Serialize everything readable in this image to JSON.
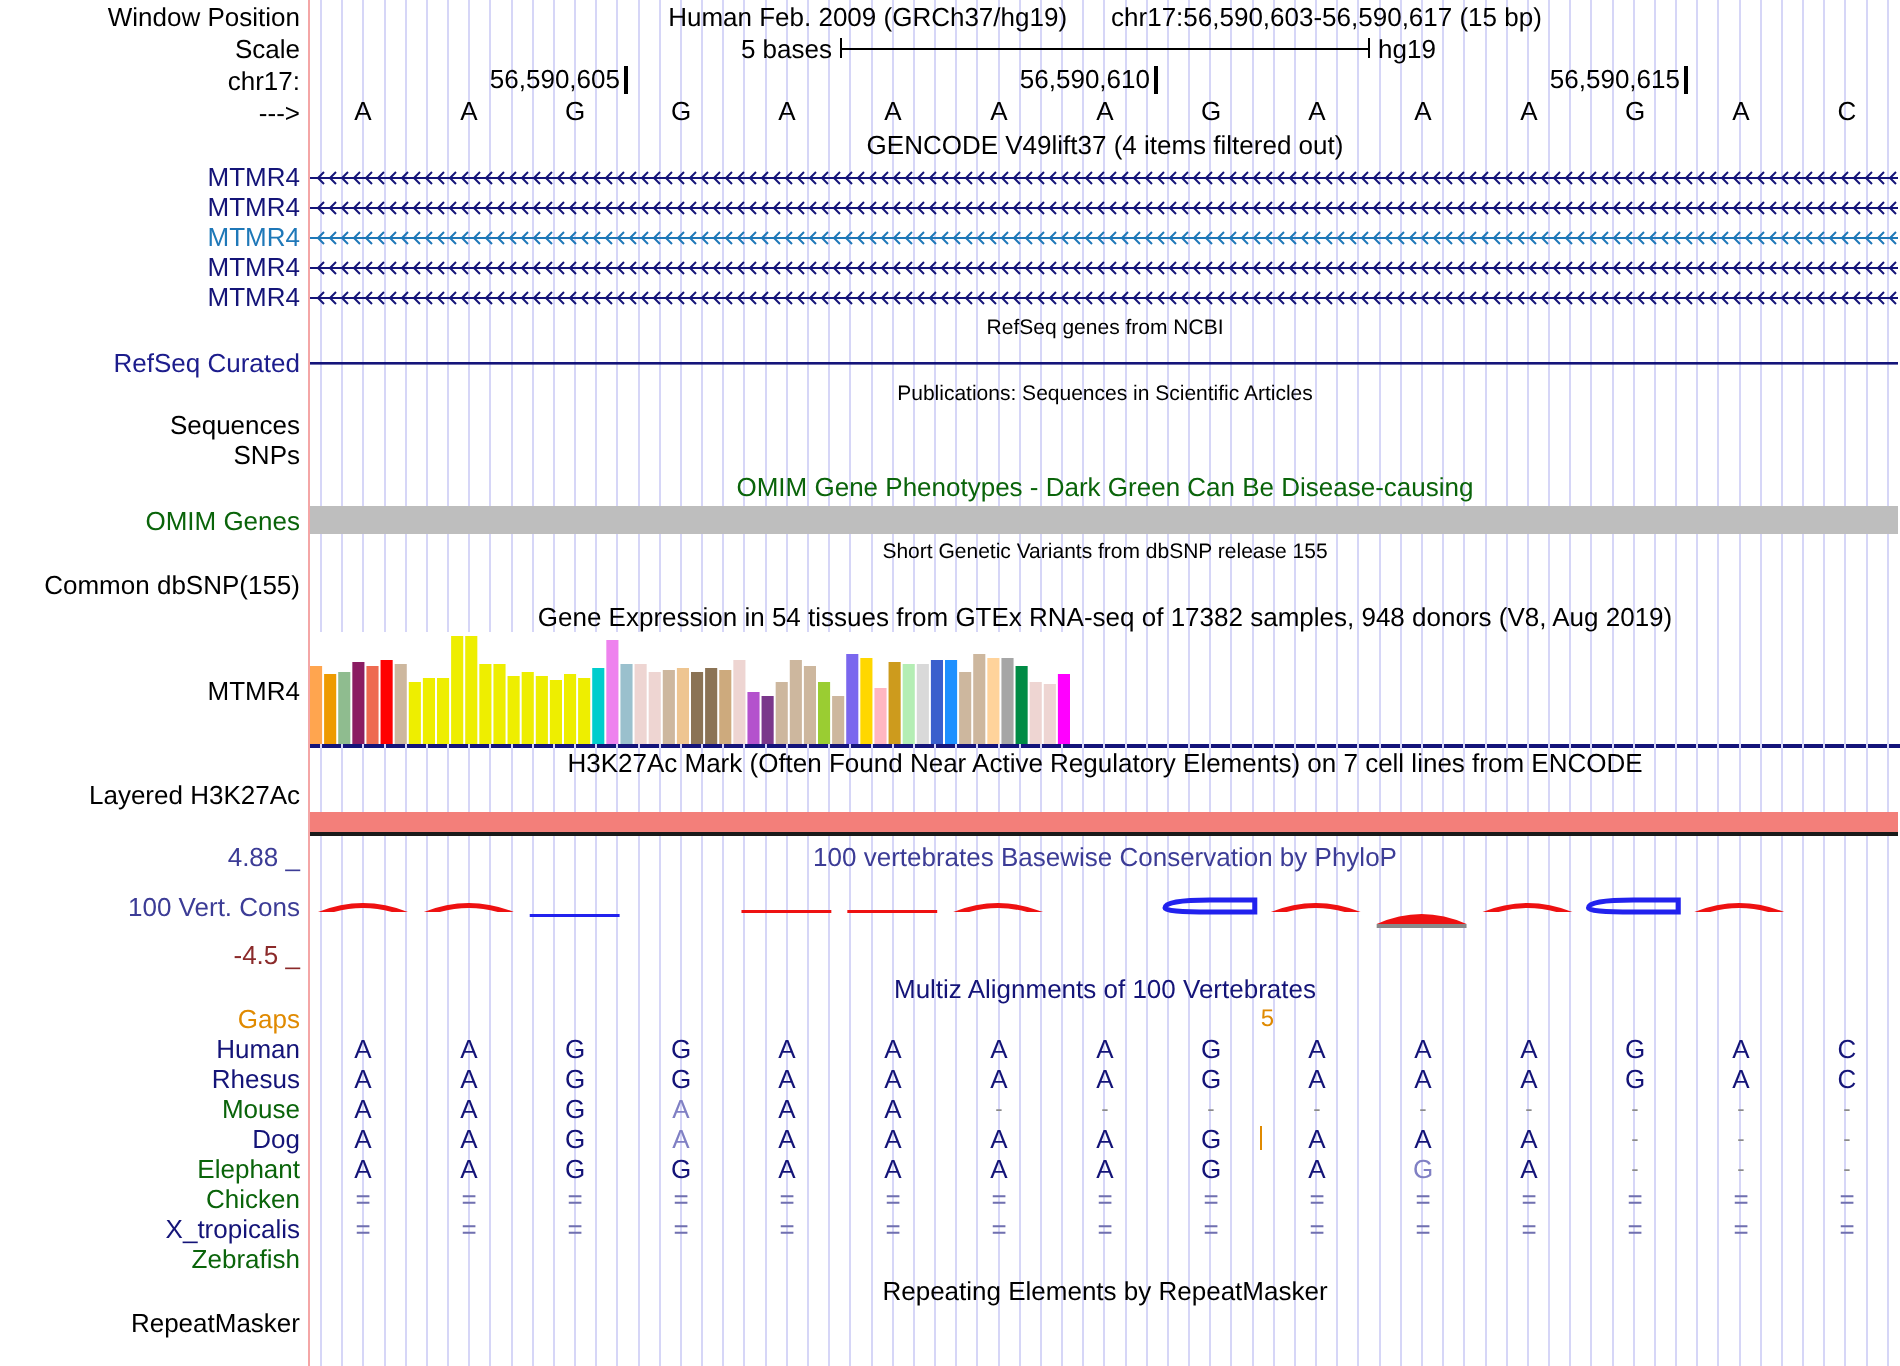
{
  "header": {
    "window_position_label": "Window Position",
    "assembly": "Human Feb. 2009 (GRCh37/hg19)",
    "position": "chr17:56,590,603-56,590,617 (15 bp)",
    "scale_label": "Scale",
    "scale_text": "5 bases",
    "scale_db": "hg19",
    "chrom_label": "chr17:",
    "strand_label": "--->",
    "bases": [
      {
        "base": "A"
      },
      {
        "base": "A"
      },
      {
        "base": "G",
        "tick": "56,590,605"
      },
      {
        "base": "G"
      },
      {
        "base": "A"
      },
      {
        "base": "A"
      },
      {
        "base": "A"
      },
      {
        "base": "A",
        "tick": "56,590,610"
      },
      {
        "base": "G"
      },
      {
        "base": "A"
      },
      {
        "base": "A"
      },
      {
        "base": "A"
      },
      {
        "base": "G",
        "tick": "56,590,615"
      },
      {
        "base": "A"
      },
      {
        "base": "C"
      }
    ]
  },
  "tracks": [
    {
      "kind": "genes",
      "title": "GENCODE V49lift37 (4 items filtered out)",
      "items": [
        {
          "label": "MTMR4",
          "color": "#141478"
        },
        {
          "label": "MTMR4",
          "color": "#141478"
        },
        {
          "label": "MTMR4",
          "color": "#1f78b8"
        },
        {
          "label": "MTMR4",
          "color": "#141478"
        },
        {
          "label": "MTMR4",
          "color": "#141478"
        }
      ]
    },
    {
      "kind": "line",
      "caption": "RefSeq genes from NCBI",
      "label": "RefSeq Curated"
    },
    {
      "kind": "labels",
      "caption": "Publications: Sequences in Scientific Articles",
      "labels": [
        "Sequences",
        "SNPs"
      ]
    },
    {
      "kind": "bar",
      "title": "OMIM Gene Phenotypes - Dark Green Can Be Disease-causing",
      "label": "OMIM Genes"
    },
    {
      "kind": "labels",
      "caption": "Short Genetic Variants from dbSNP release 155",
      "labels": [
        "Common dbSNP(155)"
      ]
    },
    {
      "kind": "expression",
      "title": "Gene Expression in 54 tissues from GTEx RNA-seq of 17382 samples, 948 donors (V8, Aug 2019)",
      "label": "MTMR4"
    },
    {
      "kind": "layered",
      "title": "H3K27Ac Mark (Often Found Near Active Regulatory Elements) on 7 cell lines from ENCODE",
      "label": "Layered H3K27Ac"
    },
    {
      "kind": "conservation",
      "title": "100 vertebrates Basewise Conservation by PhyloP",
      "label": "100 Vert. Cons",
      "max_label": "4.88 _",
      "min_label": "-4.5 _"
    },
    {
      "kind": "multiz",
      "title": "Multiz Alignments of 100 Vertebrates",
      "gaps": {
        "label": "Gaps",
        "count": "5"
      },
      "species": [
        {
          "name": "Human",
          "color": "#141478",
          "cells": [
            {
              "b": "A",
              "kind": "match",
              "insertion": false
            },
            {
              "b": "A",
              "kind": "match",
              "insertion": false
            },
            {
              "b": "G",
              "kind": "match",
              "insertion": false
            },
            {
              "b": "G",
              "kind": "match",
              "insertion": false
            },
            {
              "b": "A",
              "kind": "match",
              "insertion": false
            },
            {
              "b": "A",
              "kind": "match",
              "insertion": false
            },
            {
              "b": "A",
              "kind": "match",
              "insertion": false
            },
            {
              "b": "A",
              "kind": "match",
              "insertion": false
            },
            {
              "b": "G",
              "kind": "match",
              "insertion": false
            },
            {
              "b": "A",
              "kind": "match",
              "insertion": false
            },
            {
              "b": "A",
              "kind": "match",
              "insertion": false
            },
            {
              "b": "A",
              "kind": "match",
              "insertion": false
            },
            {
              "b": "G",
              "kind": "match",
              "insertion": false
            },
            {
              "b": "A",
              "kind": "match",
              "insertion": false
            },
            {
              "b": "C",
              "kind": "match",
              "insertion": false
            }
          ]
        },
        {
          "name": "Rhesus",
          "color": "#141478",
          "cells": [
            {
              "b": "A",
              "kind": "match",
              "insertion": false
            },
            {
              "b": "A",
              "kind": "match",
              "insertion": false
            },
            {
              "b": "G",
              "kind": "match",
              "insertion": false
            },
            {
              "b": "G",
              "kind": "match",
              "insertion": false
            },
            {
              "b": "A",
              "kind": "match",
              "insertion": false
            },
            {
              "b": "A",
              "kind": "match",
              "insertion": false
            },
            {
              "b": "A",
              "kind": "match",
              "insertion": false
            },
            {
              "b": "A",
              "kind": "match",
              "insertion": false
            },
            {
              "b": "G",
              "kind": "match",
              "insertion": false
            },
            {
              "b": "A",
              "kind": "match",
              "insertion": false
            },
            {
              "b": "A",
              "kind": "match",
              "insertion": false
            },
            {
              "b": "A",
              "kind": "match",
              "insertion": false
            },
            {
              "b": "G",
              "kind": "match",
              "insertion": false
            },
            {
              "b": "A",
              "kind": "match",
              "insertion": false
            },
            {
              "b": "C",
              "kind": "match",
              "insertion": false
            }
          ]
        },
        {
          "name": "Mouse",
          "color": "#0a640a",
          "cells": [
            {
              "b": "A",
              "kind": "match",
              "insertion": false
            },
            {
              "b": "A",
              "kind": "match",
              "insertion": false
            },
            {
              "b": "G",
              "kind": "match",
              "insertion": false
            },
            {
              "b": "A",
              "kind": "mismatch",
              "insertion": false
            },
            {
              "b": "A",
              "kind": "match",
              "insertion": false
            },
            {
              "b": "A",
              "kind": "match",
              "insertion": false
            },
            {
              "b": "-",
              "kind": "gap",
              "insertion": false
            },
            {
              "b": "-",
              "kind": "gap",
              "insertion": false
            },
            {
              "b": "-",
              "kind": "gap",
              "insertion": false
            },
            {
              "b": "-",
              "kind": "gap",
              "insertion": false
            },
            {
              "b": "-",
              "kind": "gap",
              "insertion": false
            },
            {
              "b": "-",
              "kind": "gap",
              "insertion": false
            },
            {
              "b": "-",
              "kind": "gap",
              "insertion": false
            },
            {
              "b": "-",
              "kind": "gap",
              "insertion": false
            },
            {
              "b": "-",
              "kind": "gap",
              "insertion": false
            }
          ]
        },
        {
          "name": "Dog",
          "color": "#141478",
          "cells": [
            {
              "b": "A",
              "kind": "match",
              "insertion": false
            },
            {
              "b": "A",
              "kind": "match",
              "insertion": false
            },
            {
              "b": "G",
              "kind": "match",
              "insertion": false
            },
            {
              "b": "A",
              "kind": "mismatch",
              "insertion": false
            },
            {
              "b": "A",
              "kind": "match",
              "insertion": false
            },
            {
              "b": "A",
              "kind": "match",
              "insertion": false
            },
            {
              "b": "A",
              "kind": "match",
              "insertion": false
            },
            {
              "b": "A",
              "kind": "match",
              "insertion": false
            },
            {
              "b": "G",
              "kind": "match",
              "insertion": true
            },
            {
              "b": "A",
              "kind": "match",
              "insertion": false
            },
            {
              "b": "A",
              "kind": "match",
              "insertion": false
            },
            {
              "b": "A",
              "kind": "match",
              "insertion": false
            },
            {
              "b": "-",
              "kind": "gap",
              "insertion": false
            },
            {
              "b": "-",
              "kind": "gap",
              "insertion": false
            },
            {
              "b": "-",
              "kind": "gap",
              "insertion": false
            }
          ]
        },
        {
          "name": "Elephant",
          "color": "#0a640a",
          "cells": [
            {
              "b": "A",
              "kind": "match",
              "insertion": false
            },
            {
              "b": "A",
              "kind": "match",
              "insertion": false
            },
            {
              "b": "G",
              "kind": "match",
              "insertion": false
            },
            {
              "b": "G",
              "kind": "match",
              "insertion": false
            },
            {
              "b": "A",
              "kind": "match",
              "insertion": false
            },
            {
              "b": "A",
              "kind": "match",
              "insertion": false
            },
            {
              "b": "A",
              "kind": "match",
              "insertion": false
            },
            {
              "b": "A",
              "kind": "match",
              "insertion": false
            },
            {
              "b": "G",
              "kind": "match",
              "insertion": false
            },
            {
              "b": "A",
              "kind": "match",
              "insertion": false
            },
            {
              "b": "G",
              "kind": "mismatch",
              "insertion": false
            },
            {
              "b": "A",
              "kind": "match",
              "insertion": false
            },
            {
              "b": "-",
              "kind": "gap",
              "insertion": false
            },
            {
              "b": "-",
              "kind": "gap",
              "insertion": false
            },
            {
              "b": "-",
              "kind": "gap",
              "insertion": false
            }
          ]
        },
        {
          "name": "Chicken",
          "color": "#0a640a",
          "cells": [
            {
              "b": "=",
              "kind": "unaligned",
              "insertion": false
            },
            {
              "b": "=",
              "kind": "unaligned",
              "insertion": false
            },
            {
              "b": "=",
              "kind": "unaligned",
              "insertion": false
            },
            {
              "b": "=",
              "kind": "unaligned",
              "insertion": false
            },
            {
              "b": "=",
              "kind": "unaligned",
              "insertion": false
            },
            {
              "b": "=",
              "kind": "unaligned",
              "insertion": false
            },
            {
              "b": "=",
              "kind": "unaligned",
              "insertion": false
            },
            {
              "b": "=",
              "kind": "unaligned",
              "insertion": false
            },
            {
              "b": "=",
              "kind": "unaligned",
              "insertion": false
            },
            {
              "b": "=",
              "kind": "unaligned",
              "insertion": false
            },
            {
              "b": "=",
              "kind": "unaligned",
              "insertion": false
            },
            {
              "b": "=",
              "kind": "unaligned",
              "insertion": false
            },
            {
              "b": "=",
              "kind": "unaligned",
              "insertion": false
            },
            {
              "b": "=",
              "kind": "unaligned",
              "insertion": false
            },
            {
              "b": "=",
              "kind": "unaligned",
              "insertion": false
            }
          ]
        },
        {
          "name": "X_tropicalis",
          "color": "#141478",
          "cells": [
            {
              "b": "=",
              "kind": "unaligned",
              "insertion": false
            },
            {
              "b": "=",
              "kind": "unaligned",
              "insertion": false
            },
            {
              "b": "=",
              "kind": "unaligned",
              "insertion": false
            },
            {
              "b": "=",
              "kind": "unaligned",
              "insertion": false
            },
            {
              "b": "=",
              "kind": "unaligned",
              "insertion": false
            },
            {
              "b": "=",
              "kind": "unaligned",
              "insertion": false
            },
            {
              "b": "=",
              "kind": "unaligned",
              "insertion": false
            },
            {
              "b": "=",
              "kind": "unaligned",
              "insertion": false
            },
            {
              "b": "=",
              "kind": "unaligned",
              "insertion": false
            },
            {
              "b": "=",
              "kind": "unaligned",
              "insertion": false
            },
            {
              "b": "=",
              "kind": "unaligned",
              "insertion": false
            },
            {
              "b": "=",
              "kind": "unaligned",
              "insertion": false
            },
            {
              "b": "=",
              "kind": "unaligned",
              "insertion": false
            },
            {
              "b": "=",
              "kind": "unaligned",
              "insertion": false
            },
            {
              "b": "=",
              "kind": "unaligned",
              "insertion": false
            }
          ]
        },
        {
          "name": "Zebrafish",
          "color": "#0a640a"
        }
      ]
    },
    {
      "kind": "labels",
      "title": "Repeating Elements by RepeatMasker",
      "labels": [
        "RepeatMasker"
      ]
    }
  ]
}
